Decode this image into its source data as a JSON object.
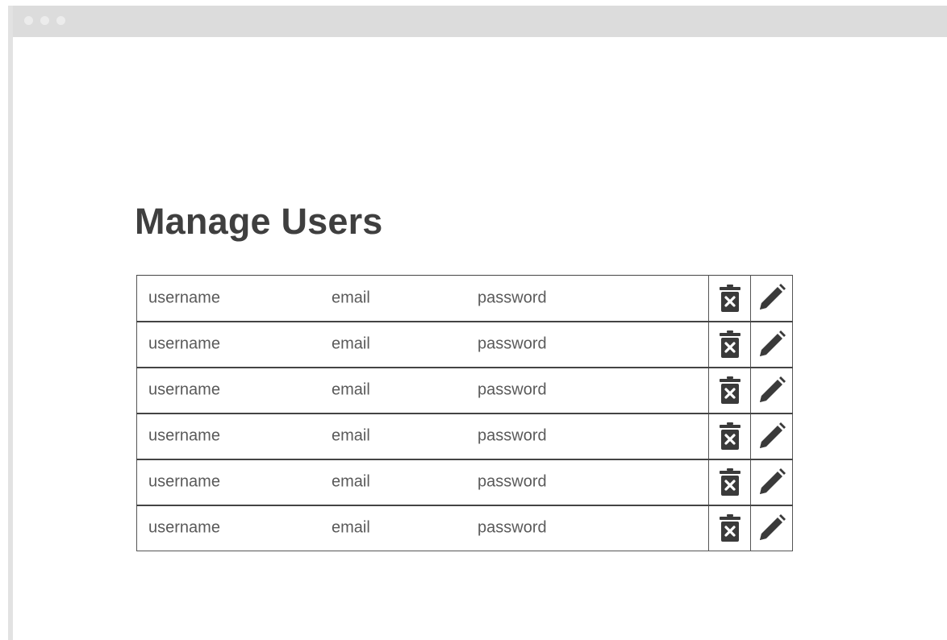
{
  "page": {
    "title": "Manage Users"
  },
  "window": {
    "titlebar_color": "#dcdcdc",
    "control_dots": 3
  },
  "table": {
    "rows": [
      {
        "username": "username",
        "email": "email",
        "password": "password",
        "actions": [
          "delete-icon",
          "edit-icon"
        ]
      },
      {
        "username": "username",
        "email": "email",
        "password": "password",
        "actions": [
          "delete-icon",
          "edit-icon"
        ]
      },
      {
        "username": "username",
        "email": "email",
        "password": "password",
        "actions": [
          "delete-icon",
          "edit-icon"
        ]
      },
      {
        "username": "username",
        "email": "email",
        "password": "password",
        "actions": [
          "delete-icon",
          "edit-icon"
        ]
      },
      {
        "username": "username",
        "email": "email",
        "password": "password",
        "actions": [
          "delete-icon",
          "edit-icon"
        ]
      },
      {
        "username": "username",
        "email": "email",
        "password": "password",
        "actions": [
          "delete-icon",
          "edit-icon"
        ]
      }
    ]
  },
  "colors": {
    "text": "#5a5a5a",
    "title": "#3f3f3f",
    "icon": "#3a3a3a",
    "border": "#444444"
  }
}
